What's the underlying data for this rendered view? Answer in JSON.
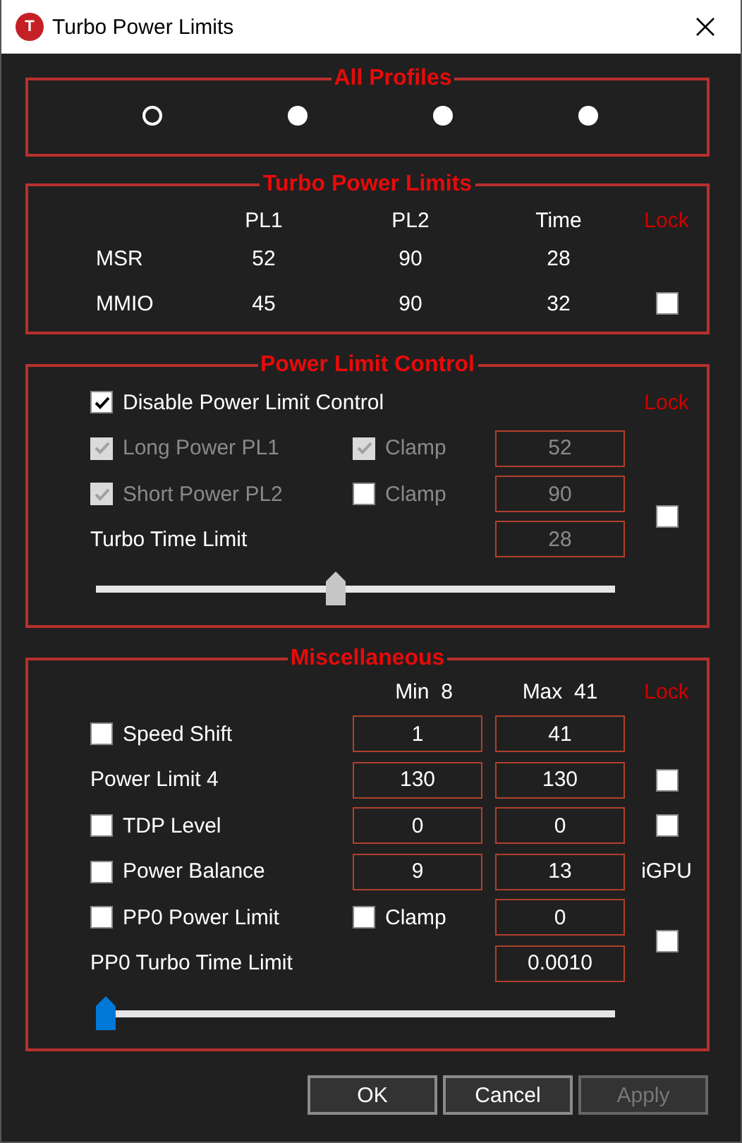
{
  "window": {
    "title": "Turbo Power Limits",
    "icon_letter": "T"
  },
  "all_profiles": {
    "title": "All Profiles",
    "profiles": [
      {
        "selected": true
      },
      {
        "selected": false
      },
      {
        "selected": false
      },
      {
        "selected": false
      }
    ]
  },
  "turbo_power_limits": {
    "title": "Turbo Power Limits",
    "columns": [
      "PL1",
      "PL2",
      "Time"
    ],
    "lock_label": "Lock",
    "rows": [
      {
        "name": "MSR",
        "values": [
          "52",
          "90",
          "28"
        ]
      },
      {
        "name": "MMIO",
        "values": [
          "45",
          "90",
          "32"
        ],
        "lock": {
          "checked": false
        }
      }
    ]
  },
  "power_limit_control": {
    "title": "Power Limit Control",
    "lock_label": "Lock",
    "disable_control": {
      "label": "Disable Power Limit Control",
      "checked": true
    },
    "lock": {
      "checked": false
    },
    "rows": [
      {
        "kind": "check",
        "label": "Long Power PL1",
        "checked": true,
        "disabled": true,
        "clamp": {
          "label": "Clamp",
          "checked": true,
          "disabled": true
        },
        "value": "52",
        "value_disabled": true
      },
      {
        "kind": "check",
        "label": "Short Power PL2",
        "checked": true,
        "disabled": true,
        "clamp": {
          "label": "Clamp",
          "checked": false,
          "disabled": false
        },
        "value": "90",
        "value_disabled": true
      },
      {
        "kind": "text",
        "label": "Turbo Time Limit",
        "value": "28",
        "value_disabled": true
      }
    ],
    "slider": {
      "level": 0.46,
      "disabled": true
    }
  },
  "miscellaneous": {
    "title": "Miscellaneous",
    "min_header": "Min  8",
    "max_header": "Max  41",
    "lock_label": "Lock",
    "rows": [
      {
        "kind": "check",
        "label": "Speed Shift",
        "checked": false,
        "min": "1",
        "max": "41"
      },
      {
        "kind": "text",
        "label": "Power Limit 4",
        "min": "130",
        "max": "130",
        "lock": {
          "checked": false
        }
      },
      {
        "kind": "check",
        "label": "TDP Level",
        "checked": false,
        "min": "0",
        "max": "0",
        "lock": {
          "checked": false
        }
      },
      {
        "kind": "check",
        "label": "Power Balance",
        "checked": false,
        "min": "9",
        "max": "13",
        "side_label": "iGPU"
      },
      {
        "kind": "check",
        "label": "PP0 Power Limit",
        "checked": false,
        "clamp": {
          "label": "Clamp",
          "checked": false
        },
        "max": "0"
      },
      {
        "kind": "text",
        "label": "PP0 Turbo Time Limit",
        "max": "0.0010"
      }
    ],
    "pp0_lock": {
      "checked": false
    },
    "slider": {
      "level": 0,
      "disabled": false
    }
  },
  "buttons": [
    {
      "label": "OK",
      "disabled": false
    },
    {
      "label": "Cancel",
      "disabled": false
    },
    {
      "label": "Apply",
      "disabled": true
    }
  ]
}
